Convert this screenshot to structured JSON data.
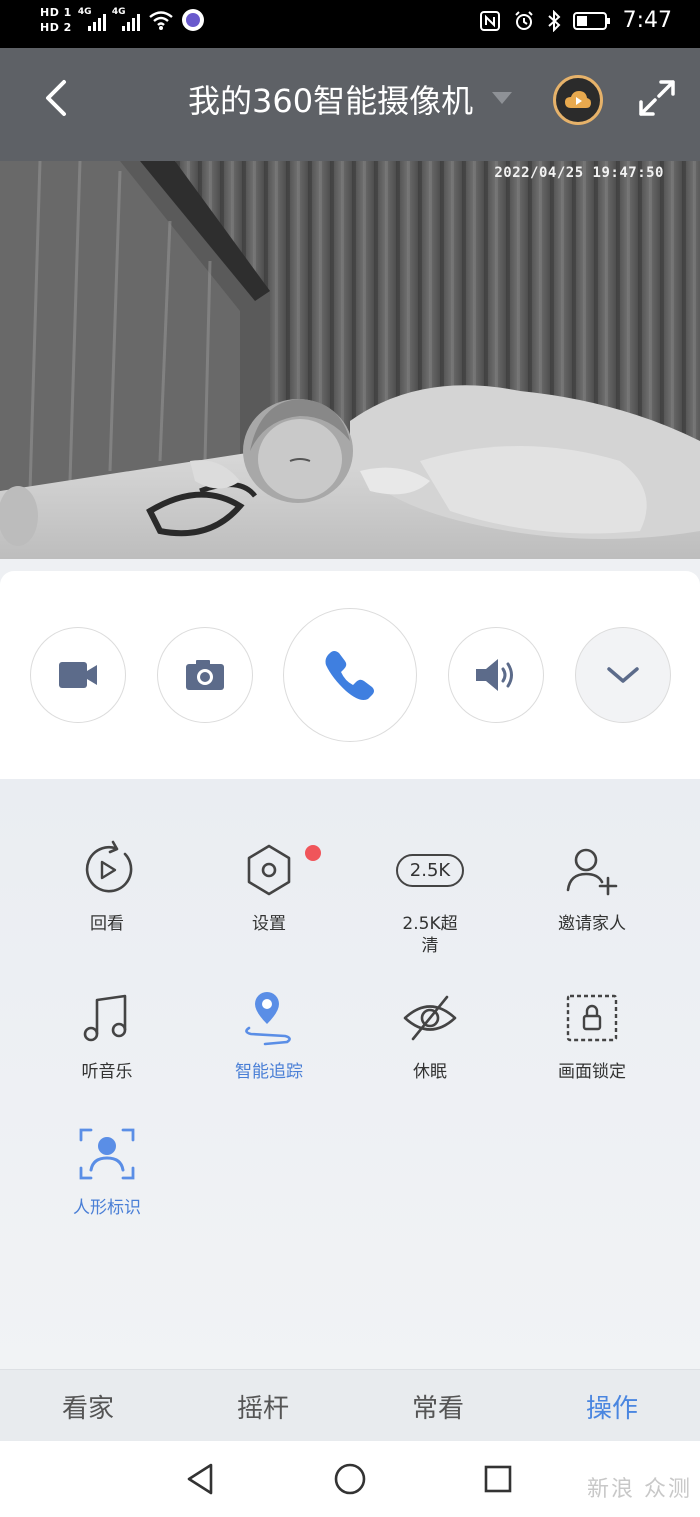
{
  "status_bar": {
    "hd1": "HD 1",
    "hd2": "HD 2",
    "net1": "4G",
    "net2": "4G",
    "time": "7:47",
    "icons": [
      "nfc-icon",
      "alarm-icon",
      "bluetooth-icon",
      "battery-icon",
      "wifi-icon",
      "app-notification-icon"
    ]
  },
  "header": {
    "title": "我的360智能摄像机",
    "icons": [
      "back-icon",
      "dropdown-icon",
      "cloud-play-icon",
      "fullscreen-icon"
    ]
  },
  "video": {
    "timestamp": "2022/04/25 19:47:50"
  },
  "controls": {
    "buttons": [
      "record-video",
      "snapshot",
      "call",
      "volume",
      "more"
    ]
  },
  "operations": {
    "items": [
      {
        "label": "回看",
        "icon": "playback-icon"
      },
      {
        "label": "设置",
        "icon": "settings-hexagon-icon",
        "badge": true
      },
      {
        "label": "2.5K超清",
        "icon": "resolution-2-5k-icon",
        "icon_text": "2.5K"
      },
      {
        "label": "邀请家人",
        "icon": "invite-user-icon"
      },
      {
        "label": "听音乐",
        "icon": "music-icon"
      },
      {
        "label": "智能追踪",
        "icon": "location-track-icon",
        "active": true
      },
      {
        "label": "休眠",
        "icon": "eye-off-icon"
      },
      {
        "label": "画面锁定",
        "icon": "lock-frame-icon"
      },
      {
        "label": "人形标识",
        "icon": "person-detect-icon",
        "active": true
      }
    ]
  },
  "tabs": {
    "items": [
      "看家",
      "摇杆",
      "常看",
      "操作"
    ],
    "active": "操作"
  },
  "nav": {
    "icons": [
      "nav-back-icon",
      "nav-home-icon",
      "nav-recent-icon"
    ]
  },
  "watermark": "新浪 众测",
  "colors": {
    "accent": "#4a86e0",
    "badge": "#f0555a",
    "header": "#5e6166",
    "cloud_ring": "#e6b26a"
  }
}
